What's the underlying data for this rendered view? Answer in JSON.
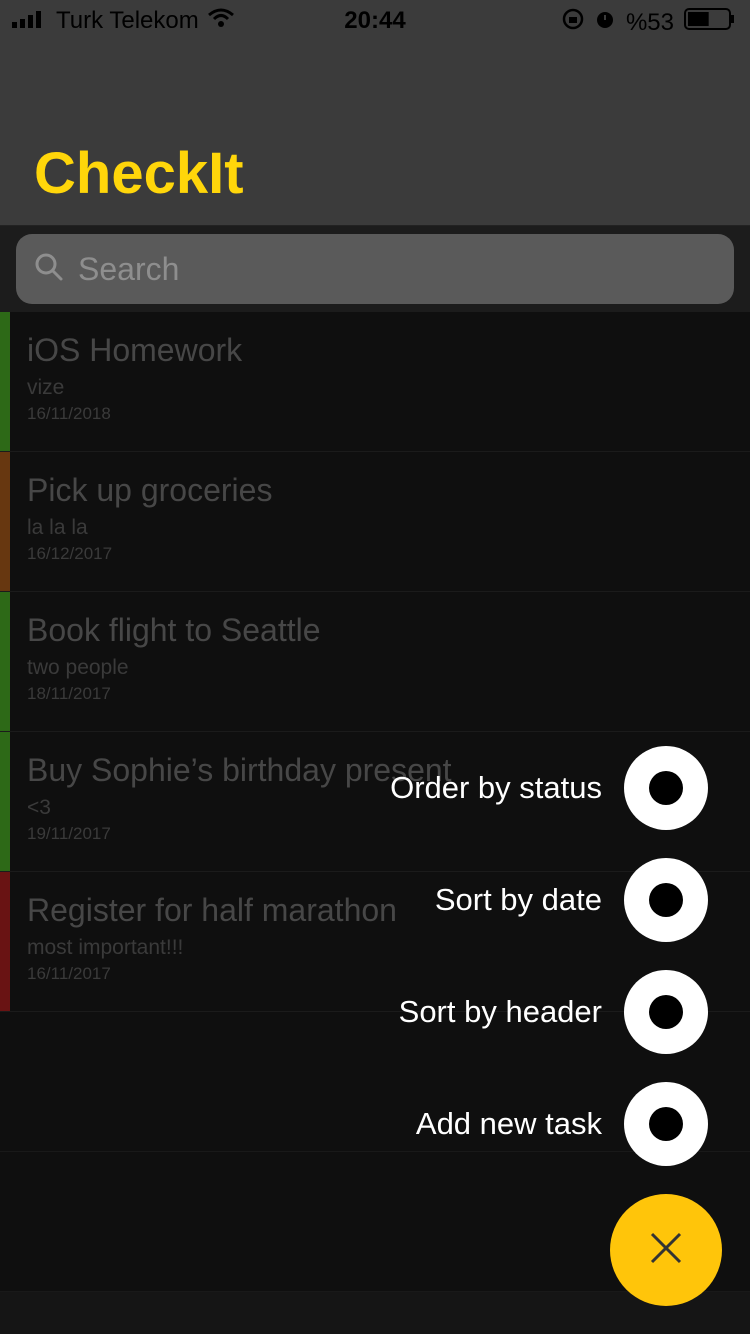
{
  "status_bar": {
    "carrier": "Turk Telekom",
    "time": "20:44",
    "battery": "%53",
    "battery_level": 0.53
  },
  "header": {
    "title": "CheckIt"
  },
  "search": {
    "placeholder": "Search"
  },
  "tasks": [
    {
      "title": "iOS Homework",
      "subtitle": "vize",
      "date": "16/11/2018",
      "status_color": "#3d8c1f"
    },
    {
      "title": "Pick up groceries",
      "subtitle": "la la la",
      "date": "16/12/2017",
      "status_color": "#8a4a16"
    },
    {
      "title": "Book flight to Seattle",
      "subtitle": "two people",
      "date": "18/11/2017",
      "status_color": "#3d8c1f"
    },
    {
      "title": "Buy Sophie’s birthday present",
      "subtitle": "<3",
      "date": "19/11/2017",
      "status_color": "#3d8c1f"
    },
    {
      "title": "Register for half marathon",
      "subtitle": "most important!!!",
      "date": "16/11/2017",
      "status_color": "#8c1a1a"
    }
  ],
  "fab_menu": {
    "items": [
      {
        "label": "Order by status"
      },
      {
        "label": "Sort by date"
      },
      {
        "label": "Sort by header"
      },
      {
        "label": "Add new task"
      }
    ],
    "close_icon": "close-icon"
  },
  "colors": {
    "accent": "#ffd60a",
    "fab": "#ffc50a"
  }
}
